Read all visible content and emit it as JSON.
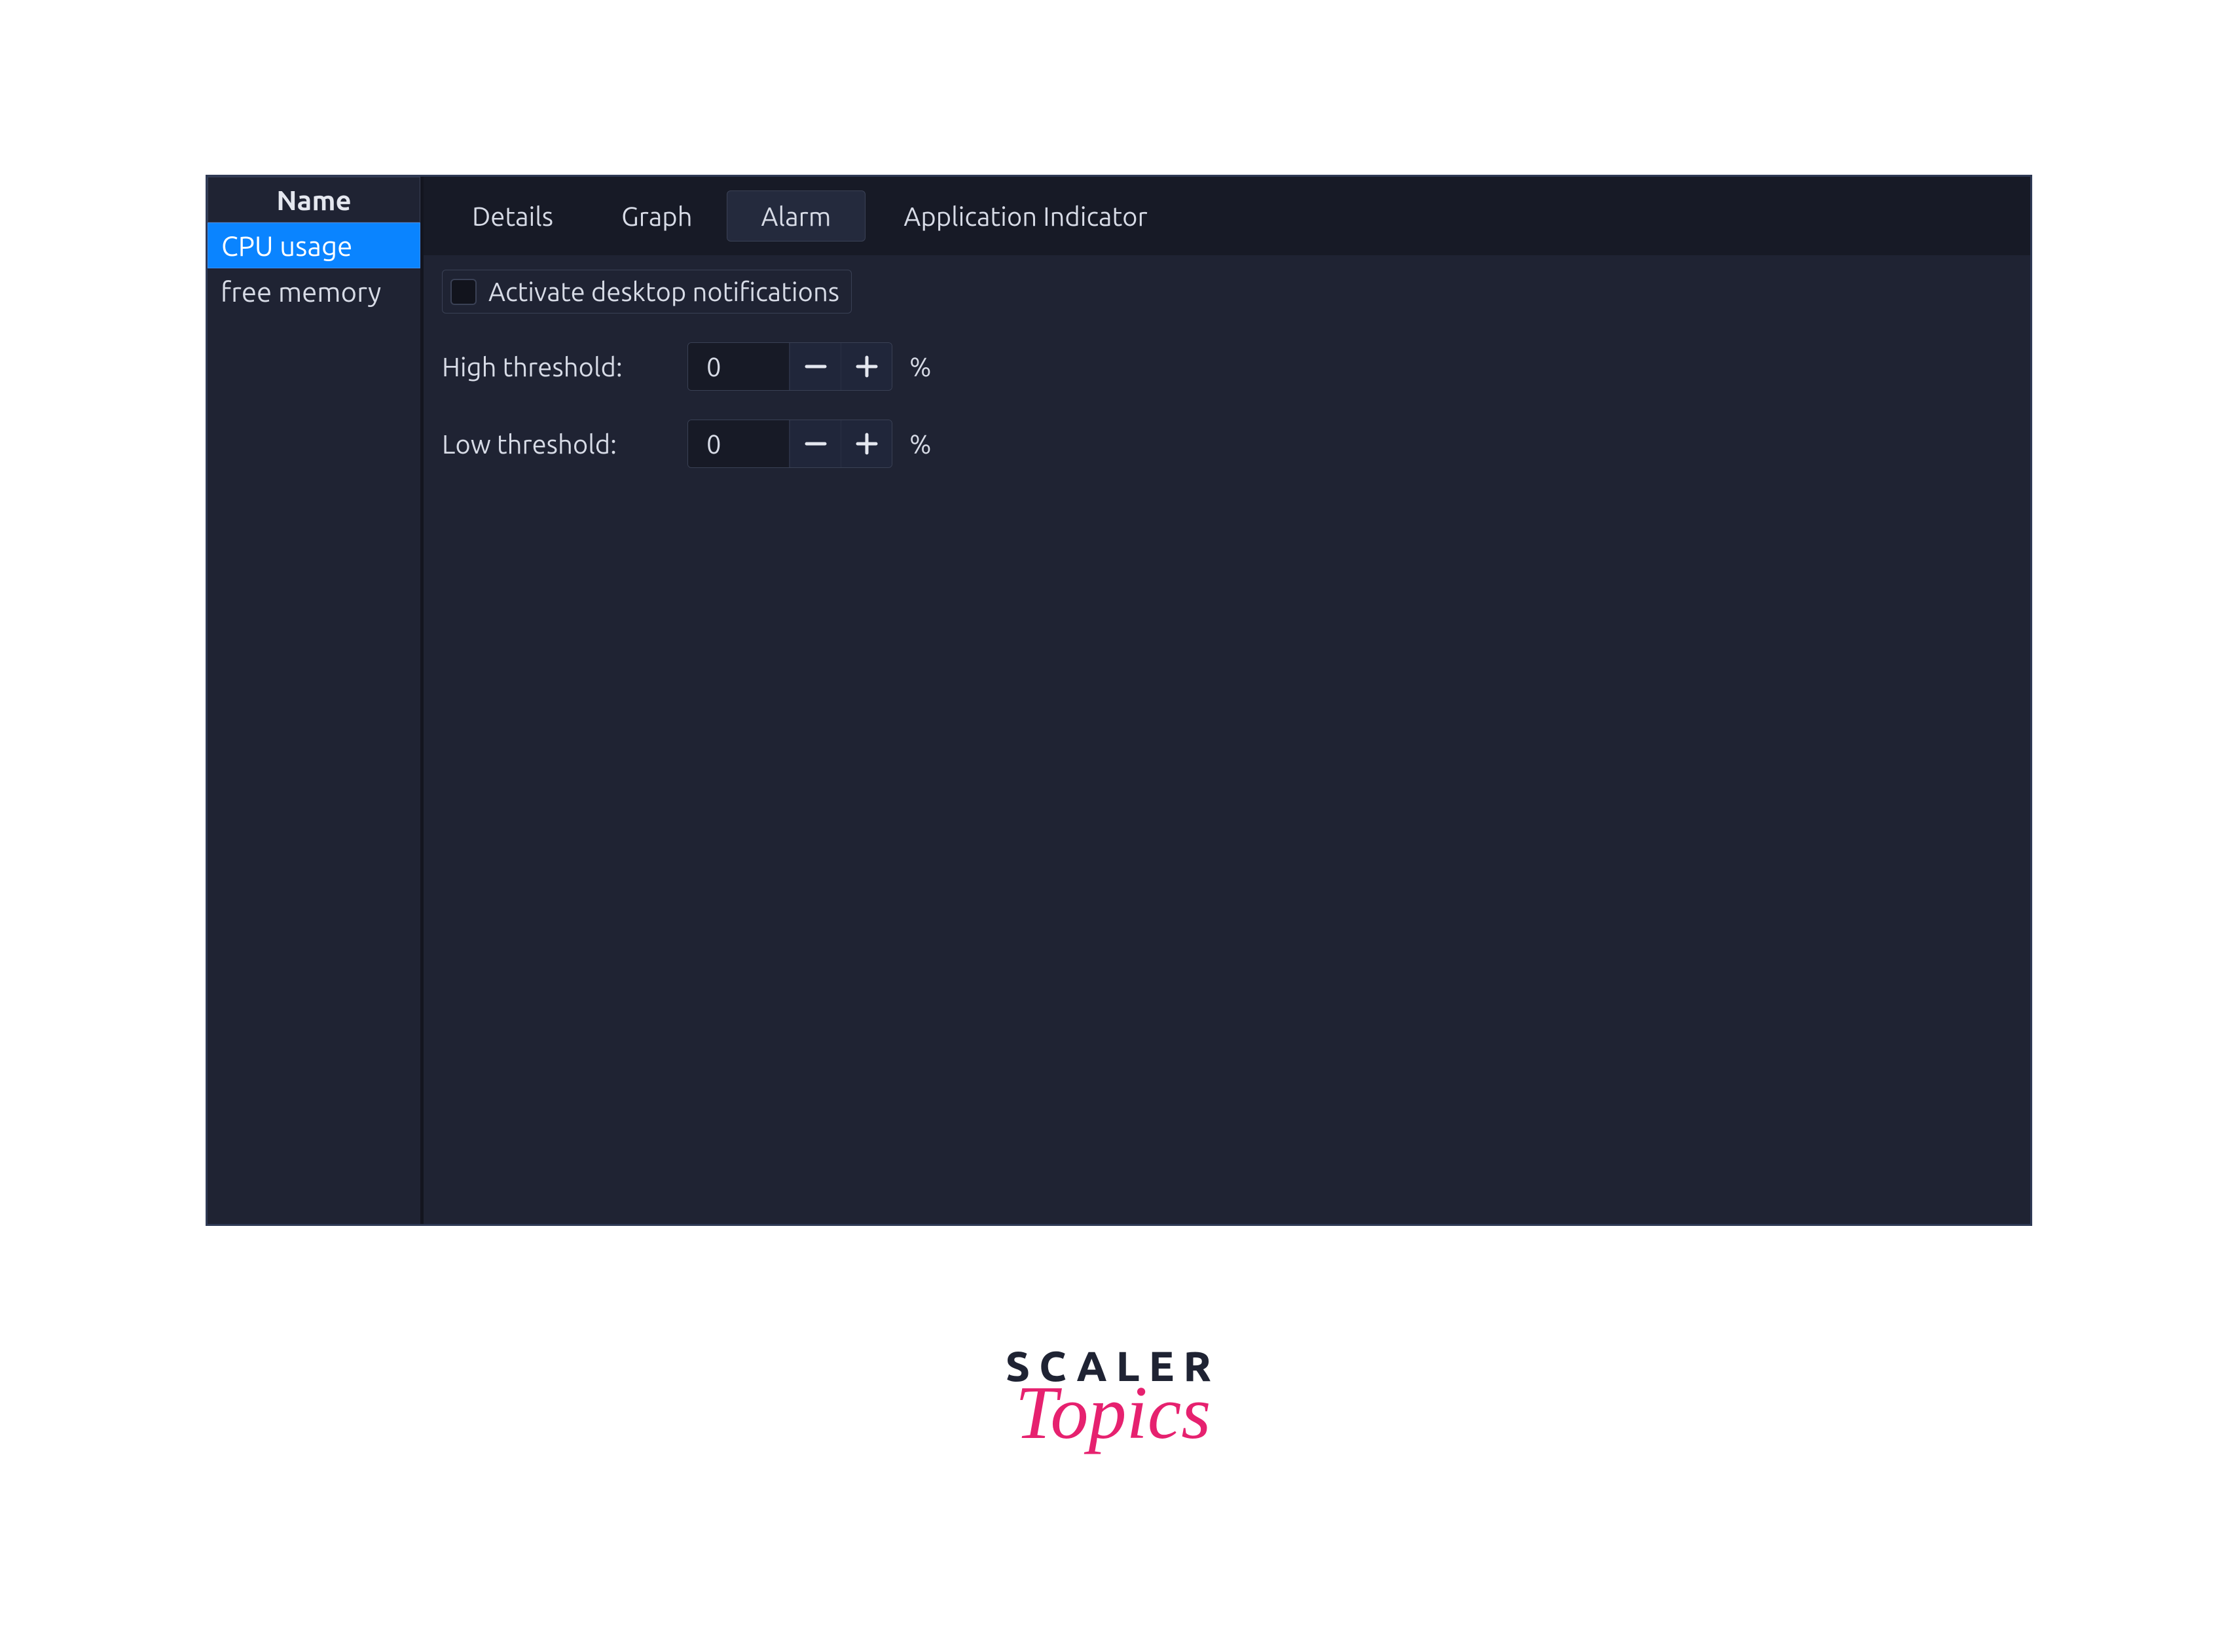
{
  "sidebar": {
    "header": "Name",
    "items": [
      {
        "label": "CPU usage",
        "selected": true
      },
      {
        "label": "free memory",
        "selected": false
      }
    ]
  },
  "tabs": [
    {
      "label": "Details",
      "active": false
    },
    {
      "label": "Graph",
      "active": false
    },
    {
      "label": "Alarm",
      "active": true
    },
    {
      "label": "Application Indicator",
      "active": false
    }
  ],
  "alarm": {
    "notifications_label": "Activate desktop notifications",
    "notifications_checked": false,
    "high_label": "High threshold:",
    "high_value": "0",
    "low_label": "Low threshold:",
    "low_value": "0",
    "unit": "%"
  },
  "brand": {
    "word": "SCALER",
    "script": "Topics"
  }
}
